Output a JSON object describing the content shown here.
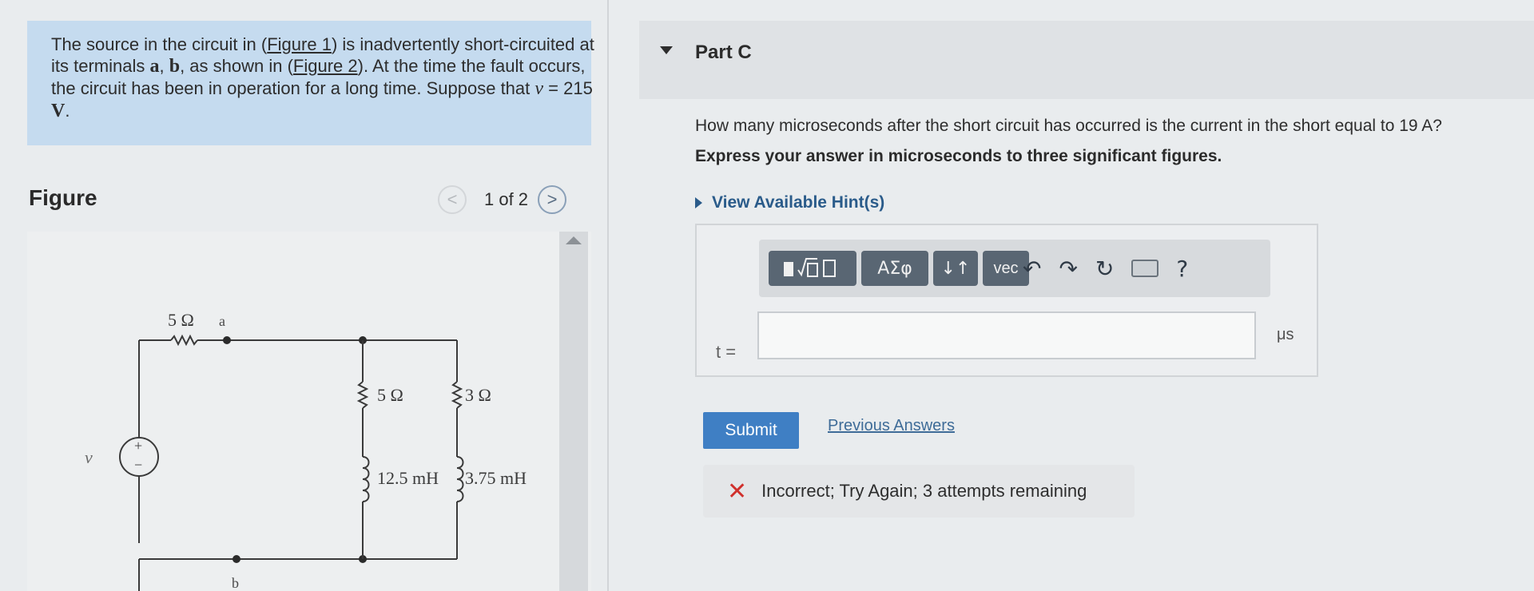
{
  "problem": {
    "text_1": "The source in the circuit in (",
    "link_1": "Figure 1",
    "text_2": ") is inadvertently short-circuited at its terminals ",
    "term_a": "a",
    "comma": ", ",
    "term_b": "b",
    "text_3": ", as shown in (",
    "link_2": "Figure 2",
    "text_4": "). At the time the fault occurs, the circuit has been in operation for a long time. Suppose that ",
    "var_v": "v",
    "equals": " = 215 ",
    "unit_V": "V",
    "period": "."
  },
  "figure": {
    "heading": "Figure",
    "pager": "1 of 2",
    "prev_symbol": "<",
    "next_symbol": ">",
    "circuit_labels": {
      "r1": "5 Ω",
      "node_a": "a",
      "node_b": "b",
      "r2": "5 Ω",
      "r3": "3 Ω",
      "l1": "12.5 mH",
      "l2": "3.75 mH",
      "source_var": "v",
      "plus": "+",
      "minus": "−"
    }
  },
  "part": {
    "title": "Part C",
    "question": "How many microseconds after the short circuit has occurred is the current in the short equal to 19 A?",
    "instruction": "Express your answer in microseconds to three significant figures.",
    "hint_label": "View Available Hint(s)"
  },
  "toolbar": {
    "greek": "ΑΣφ",
    "sort": "↓↑",
    "vec": "vec",
    "undo": "↶",
    "redo": "↷",
    "reset": "↻",
    "help": "?"
  },
  "answer": {
    "variable": "t =",
    "value": "",
    "unit": "μs"
  },
  "actions": {
    "submit": "Submit",
    "previous_answers": "Previous Answers"
  },
  "feedback": {
    "icon": "✕",
    "text": "Incorrect; Try Again; 3 attempts remaining"
  },
  "colors": {
    "problem_bg": "#c5dbef",
    "toolbar_button": "#596673",
    "submit": "#3f7fc4",
    "error": "#d0312d",
    "link": "#2a5b8a"
  }
}
